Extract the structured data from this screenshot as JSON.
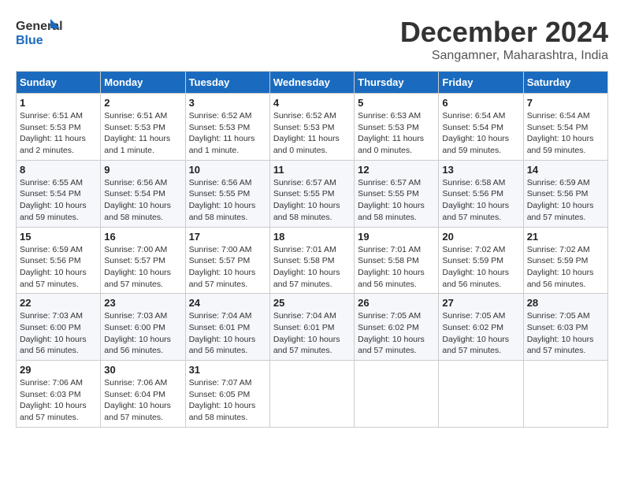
{
  "logo": {
    "text_general": "General",
    "text_blue": "Blue"
  },
  "header": {
    "title": "December 2024",
    "subtitle": "Sangamner, Maharashtra, India"
  },
  "weekdays": [
    "Sunday",
    "Monday",
    "Tuesday",
    "Wednesday",
    "Thursday",
    "Friday",
    "Saturday"
  ],
  "weeks": [
    [
      {
        "day": "1",
        "sunrise": "6:51 AM",
        "sunset": "5:53 PM",
        "daylight": "11 hours and 2 minutes."
      },
      {
        "day": "2",
        "sunrise": "6:51 AM",
        "sunset": "5:53 PM",
        "daylight": "11 hours and 1 minute."
      },
      {
        "day": "3",
        "sunrise": "6:52 AM",
        "sunset": "5:53 PM",
        "daylight": "11 hours and 1 minute."
      },
      {
        "day": "4",
        "sunrise": "6:52 AM",
        "sunset": "5:53 PM",
        "daylight": "11 hours and 0 minutes."
      },
      {
        "day": "5",
        "sunrise": "6:53 AM",
        "sunset": "5:53 PM",
        "daylight": "11 hours and 0 minutes."
      },
      {
        "day": "6",
        "sunrise": "6:54 AM",
        "sunset": "5:54 PM",
        "daylight": "10 hours and 59 minutes."
      },
      {
        "day": "7",
        "sunrise": "6:54 AM",
        "sunset": "5:54 PM",
        "daylight": "10 hours and 59 minutes."
      }
    ],
    [
      {
        "day": "8",
        "sunrise": "6:55 AM",
        "sunset": "5:54 PM",
        "daylight": "10 hours and 59 minutes."
      },
      {
        "day": "9",
        "sunrise": "6:56 AM",
        "sunset": "5:54 PM",
        "daylight": "10 hours and 58 minutes."
      },
      {
        "day": "10",
        "sunrise": "6:56 AM",
        "sunset": "5:55 PM",
        "daylight": "10 hours and 58 minutes."
      },
      {
        "day": "11",
        "sunrise": "6:57 AM",
        "sunset": "5:55 PM",
        "daylight": "10 hours and 58 minutes."
      },
      {
        "day": "12",
        "sunrise": "6:57 AM",
        "sunset": "5:55 PM",
        "daylight": "10 hours and 58 minutes."
      },
      {
        "day": "13",
        "sunrise": "6:58 AM",
        "sunset": "5:56 PM",
        "daylight": "10 hours and 57 minutes."
      },
      {
        "day": "14",
        "sunrise": "6:59 AM",
        "sunset": "5:56 PM",
        "daylight": "10 hours and 57 minutes."
      }
    ],
    [
      {
        "day": "15",
        "sunrise": "6:59 AM",
        "sunset": "5:56 PM",
        "daylight": "10 hours and 57 minutes."
      },
      {
        "day": "16",
        "sunrise": "7:00 AM",
        "sunset": "5:57 PM",
        "daylight": "10 hours and 57 minutes."
      },
      {
        "day": "17",
        "sunrise": "7:00 AM",
        "sunset": "5:57 PM",
        "daylight": "10 hours and 57 minutes."
      },
      {
        "day": "18",
        "sunrise": "7:01 AM",
        "sunset": "5:58 PM",
        "daylight": "10 hours and 57 minutes."
      },
      {
        "day": "19",
        "sunrise": "7:01 AM",
        "sunset": "5:58 PM",
        "daylight": "10 hours and 56 minutes."
      },
      {
        "day": "20",
        "sunrise": "7:02 AM",
        "sunset": "5:59 PM",
        "daylight": "10 hours and 56 minutes."
      },
      {
        "day": "21",
        "sunrise": "7:02 AM",
        "sunset": "5:59 PM",
        "daylight": "10 hours and 56 minutes."
      }
    ],
    [
      {
        "day": "22",
        "sunrise": "7:03 AM",
        "sunset": "6:00 PM",
        "daylight": "10 hours and 56 minutes."
      },
      {
        "day": "23",
        "sunrise": "7:03 AM",
        "sunset": "6:00 PM",
        "daylight": "10 hours and 56 minutes."
      },
      {
        "day": "24",
        "sunrise": "7:04 AM",
        "sunset": "6:01 PM",
        "daylight": "10 hours and 56 minutes."
      },
      {
        "day": "25",
        "sunrise": "7:04 AM",
        "sunset": "6:01 PM",
        "daylight": "10 hours and 57 minutes."
      },
      {
        "day": "26",
        "sunrise": "7:05 AM",
        "sunset": "6:02 PM",
        "daylight": "10 hours and 57 minutes."
      },
      {
        "day": "27",
        "sunrise": "7:05 AM",
        "sunset": "6:02 PM",
        "daylight": "10 hours and 57 minutes."
      },
      {
        "day": "28",
        "sunrise": "7:05 AM",
        "sunset": "6:03 PM",
        "daylight": "10 hours and 57 minutes."
      }
    ],
    [
      {
        "day": "29",
        "sunrise": "7:06 AM",
        "sunset": "6:03 PM",
        "daylight": "10 hours and 57 minutes."
      },
      {
        "day": "30",
        "sunrise": "7:06 AM",
        "sunset": "6:04 PM",
        "daylight": "10 hours and 57 minutes."
      },
      {
        "day": "31",
        "sunrise": "7:07 AM",
        "sunset": "6:05 PM",
        "daylight": "10 hours and 58 minutes."
      },
      null,
      null,
      null,
      null
    ]
  ]
}
